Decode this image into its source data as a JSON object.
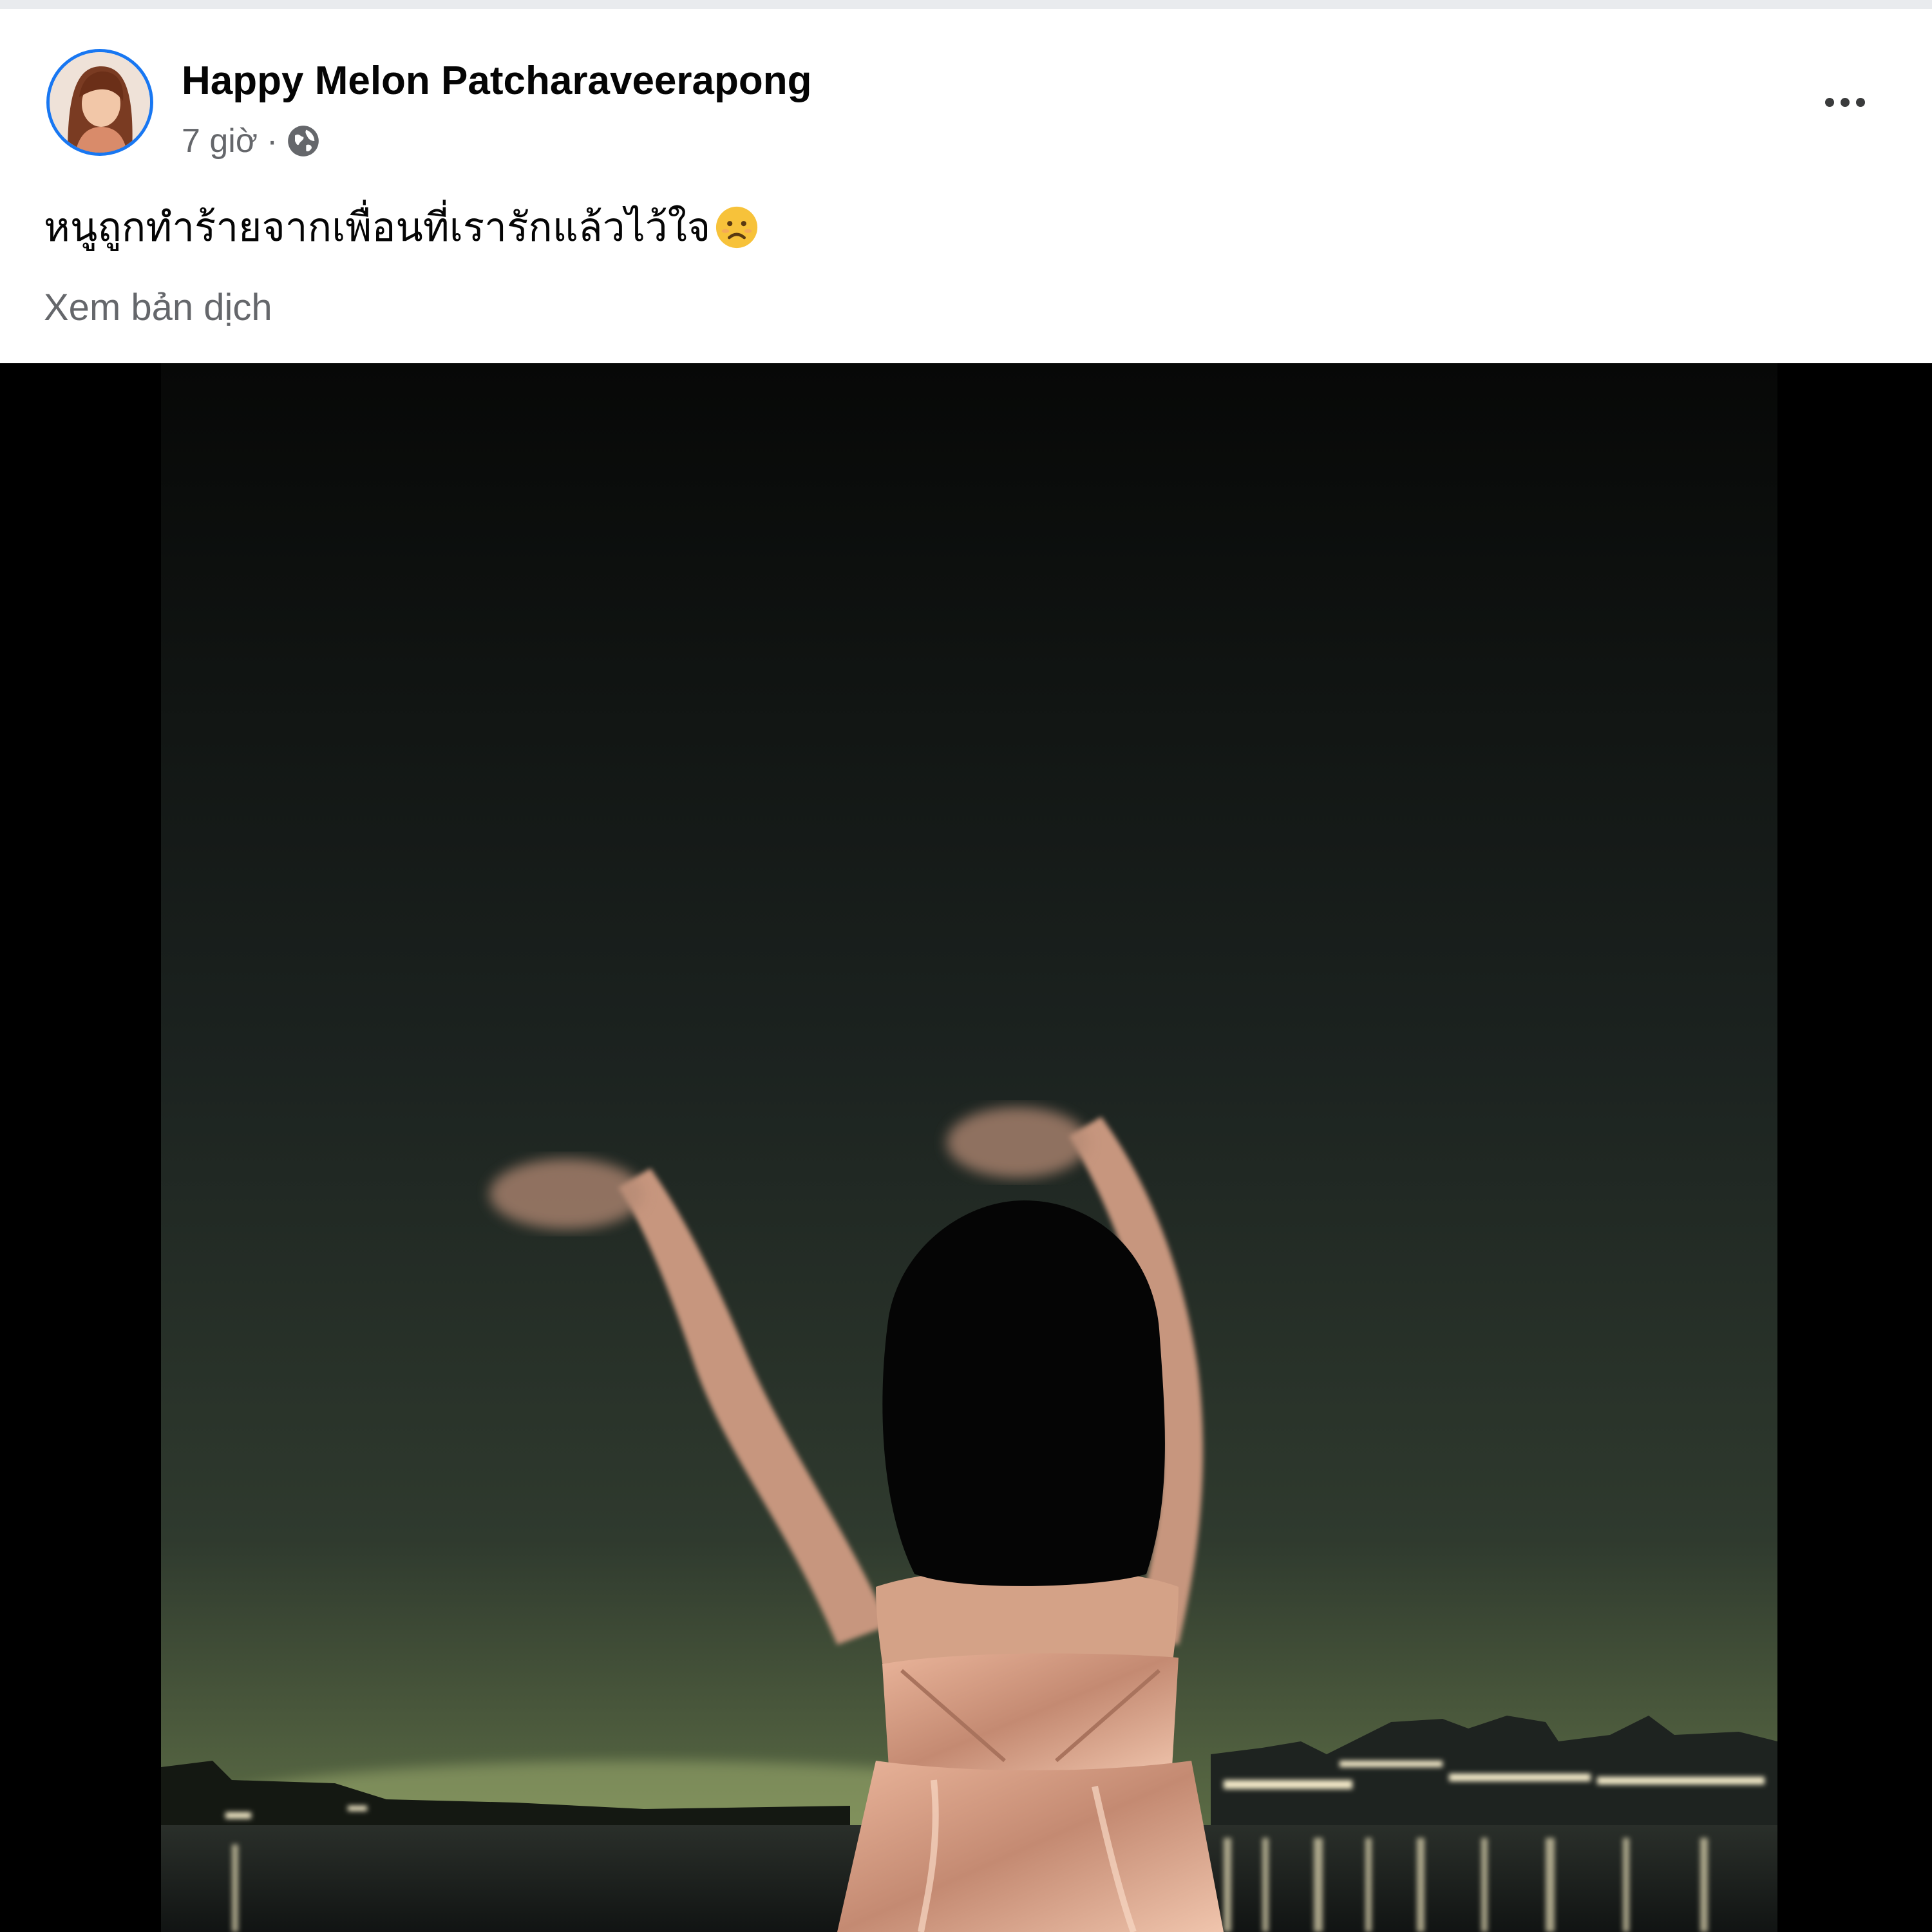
{
  "post": {
    "author": "Happy Melon Patcharaveerapong",
    "time": "7 giờ",
    "separator": "·",
    "privacy_icon": "globe-icon",
    "more_icon": "more-options-icon",
    "text": "หนูถูกทำร้ายจากเพื่อนที่เรารักแล้วไว้ใจ",
    "text_emoji": "sad-face-emoji",
    "translate_link": "Xem bản dịch"
  },
  "photo": {
    "description_icon": "night-riverside-photo"
  },
  "colors": {
    "name": "#050505",
    "secondary": "#65676b",
    "avatar_ring": "#1877f2"
  }
}
